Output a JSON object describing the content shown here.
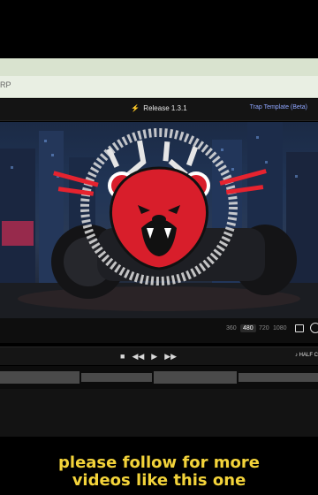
{
  "browser": {
    "url_fragment": "RP"
  },
  "app": {
    "release": "Release 1.3.1",
    "template_link": "Trap Template (Beta)"
  },
  "resolutions": [
    "360",
    "480",
    "720",
    "1080"
  ],
  "resolution_selected": "480",
  "transport": {
    "stop": "■",
    "rewind": "◀◀",
    "play": "▶",
    "forward": "▶▶"
  },
  "half_label": "HALF C",
  "caption": {
    "line1": "please follow for more",
    "line2": "videos like this one"
  },
  "colors": {
    "accent": "#ff4a2a",
    "link": "#8fa6ff",
    "caption": "#f3d33a",
    "bear_red": "#d81e2b"
  }
}
